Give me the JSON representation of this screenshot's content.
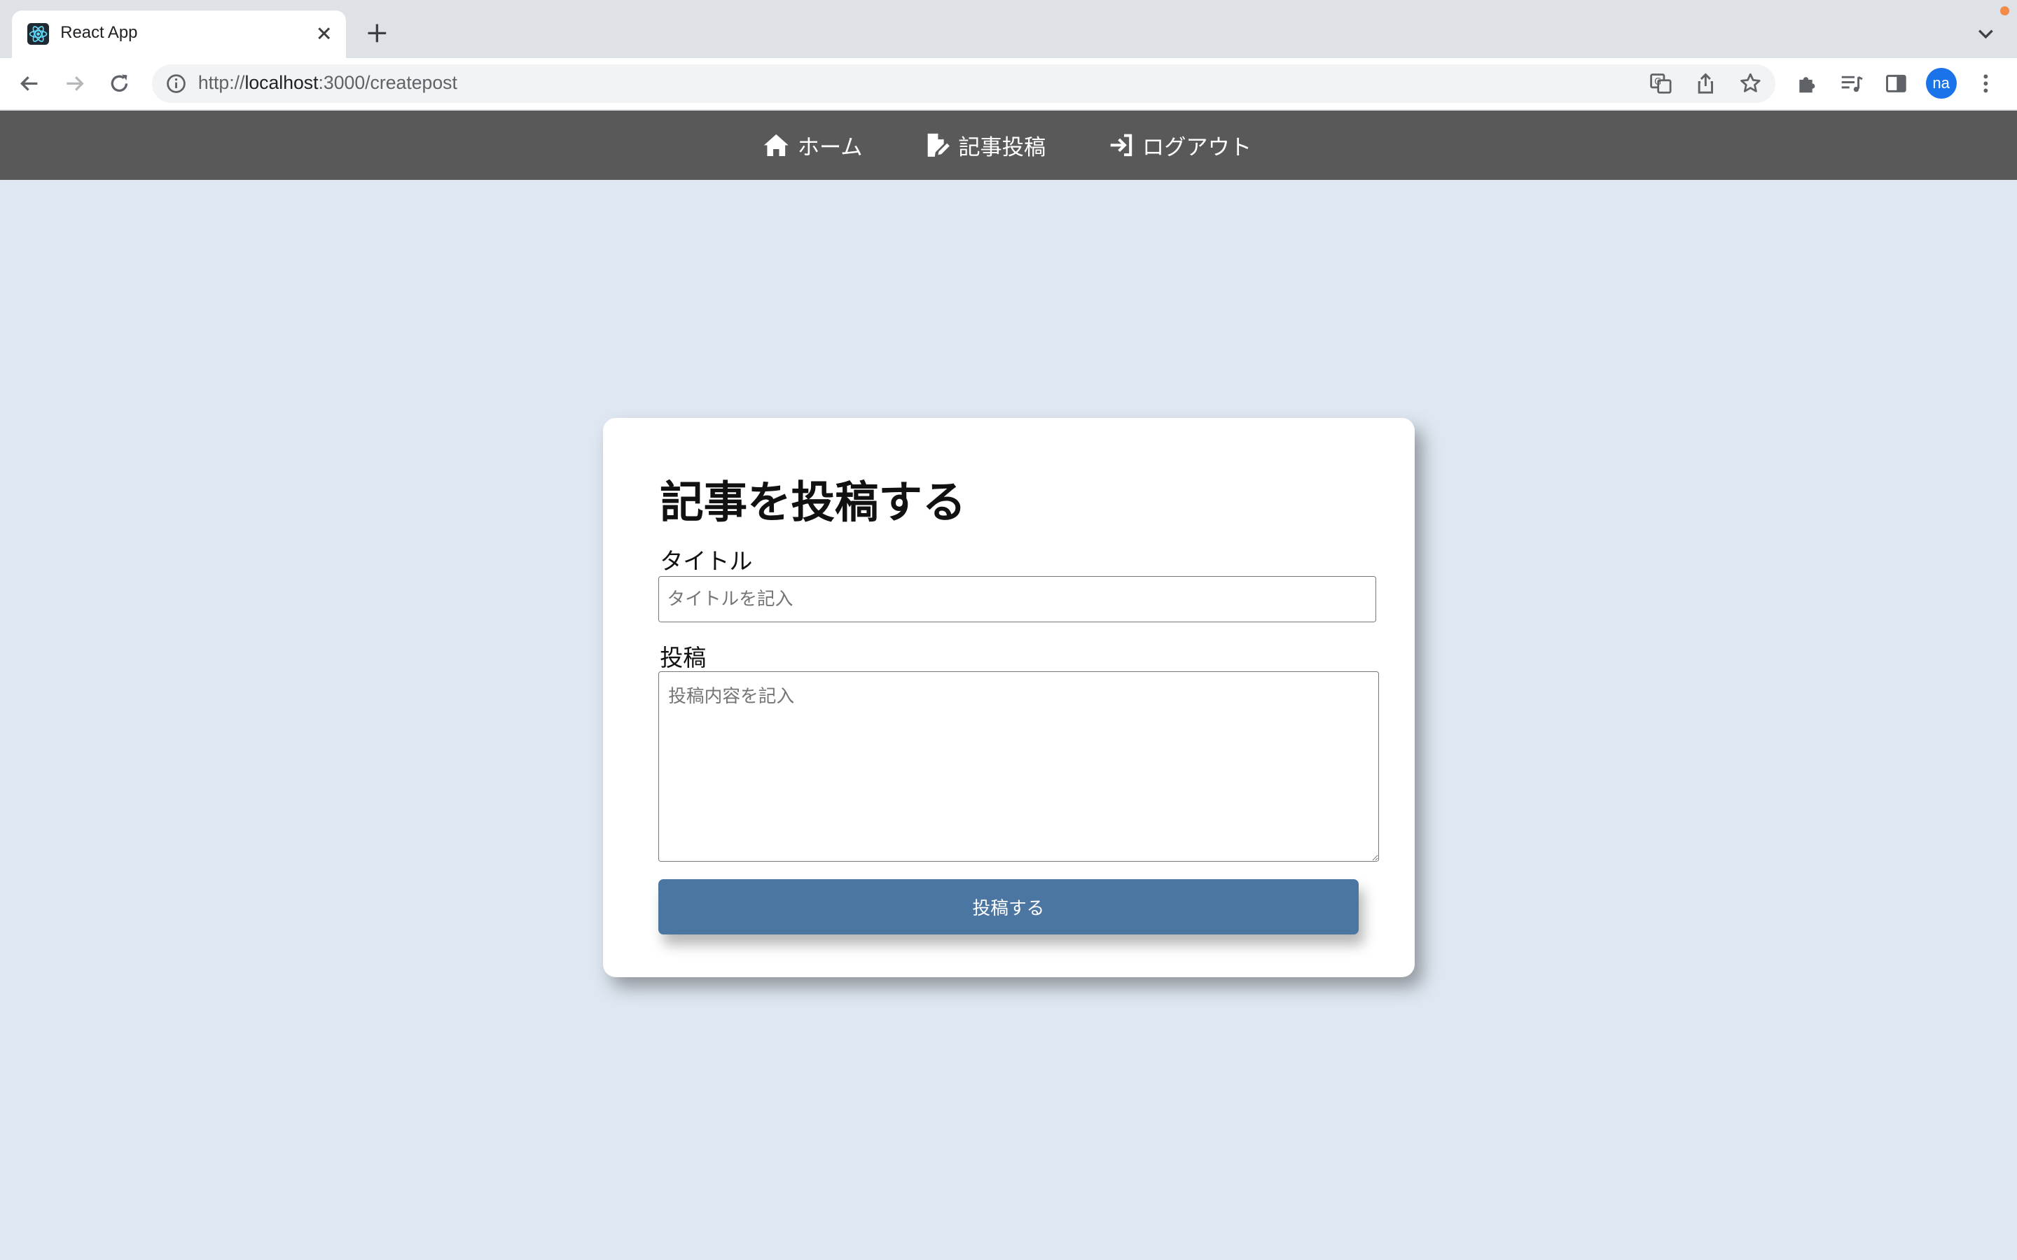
{
  "browser": {
    "tab_title": "React App",
    "url_scheme": "http://",
    "url_host": "localhost",
    "url_rest": ":3000/createpost",
    "profile_initials": "na",
    "icons": [
      "react-favicon-icon",
      "close-icon",
      "plus-icon",
      "chevron-down-icon",
      "back-arrow-icon",
      "forward-arrow-icon",
      "reload-icon",
      "info-icon",
      "translate-icon",
      "share-icon",
      "star-icon",
      "puzzle-icon",
      "media-queue-icon",
      "side-panel-icon",
      "kebab-menu-icon"
    ]
  },
  "navbar": {
    "items": [
      {
        "label": "ホーム",
        "icon": "home-icon"
      },
      {
        "label": "記事投稿",
        "icon": "file-pen-icon"
      },
      {
        "label": "ログアウト",
        "icon": "sign-in-arrow-icon"
      }
    ],
    "background": "#595959"
  },
  "form": {
    "heading": "記事を投稿する",
    "title_label": "タイトル",
    "title_placeholder": "タイトルを記入",
    "title_value": "",
    "post_label": "投稿",
    "post_placeholder": "投稿内容を記入",
    "post_value": "",
    "submit_label": "投稿する",
    "accent": "#4b76a1"
  },
  "page_background": "#dfe8f2"
}
